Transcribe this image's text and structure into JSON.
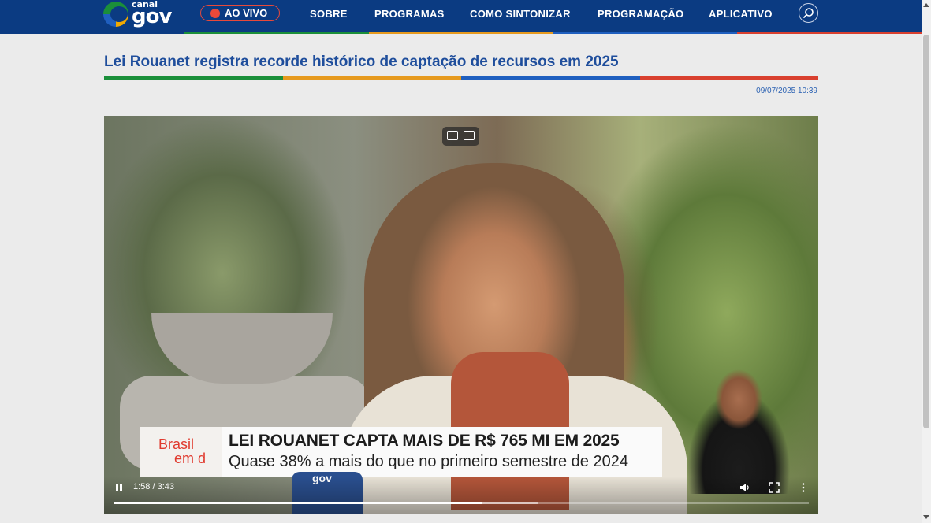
{
  "header": {
    "logo": {
      "small": "canal",
      "big": "gov"
    },
    "live_button": "AO VIVO",
    "nav": [
      "SOBRE",
      "PROGRAMAS",
      "COMO SINTONIZAR",
      "PROGRAMAÇÃO",
      "APLICATIVO"
    ],
    "search_icon": "search-icon"
  },
  "colors": {
    "nav_bg": "#0b3b82",
    "stripe": [
      "#1b8f3a",
      "#e69a1e",
      "#1f5fbf",
      "#d9402f"
    ],
    "headline": "#1f4e9c",
    "live_accent": "#e8493a"
  },
  "article": {
    "title": "Lei Rouanet registra recorde histórico de captação de recursos em 2025",
    "date": "09/07/2025 10:39"
  },
  "video": {
    "program_badge": {
      "line1": "Brasil",
      "line2": "em d"
    },
    "lower_third_title": "LEI ROUANET CAPTA MAIS DE R$ 765 MI EM 2025",
    "lower_third_subtitle": "Quase 38% a mais do que no primeiro semestre de 2024",
    "mic_label": "gov",
    "time": "1:58 / 3:43",
    "progress": 0.529,
    "buffered": 0.61,
    "controls_icons": [
      "pause-icon",
      "volume-icon",
      "fullscreen-icon",
      "more-options-icon"
    ]
  }
}
